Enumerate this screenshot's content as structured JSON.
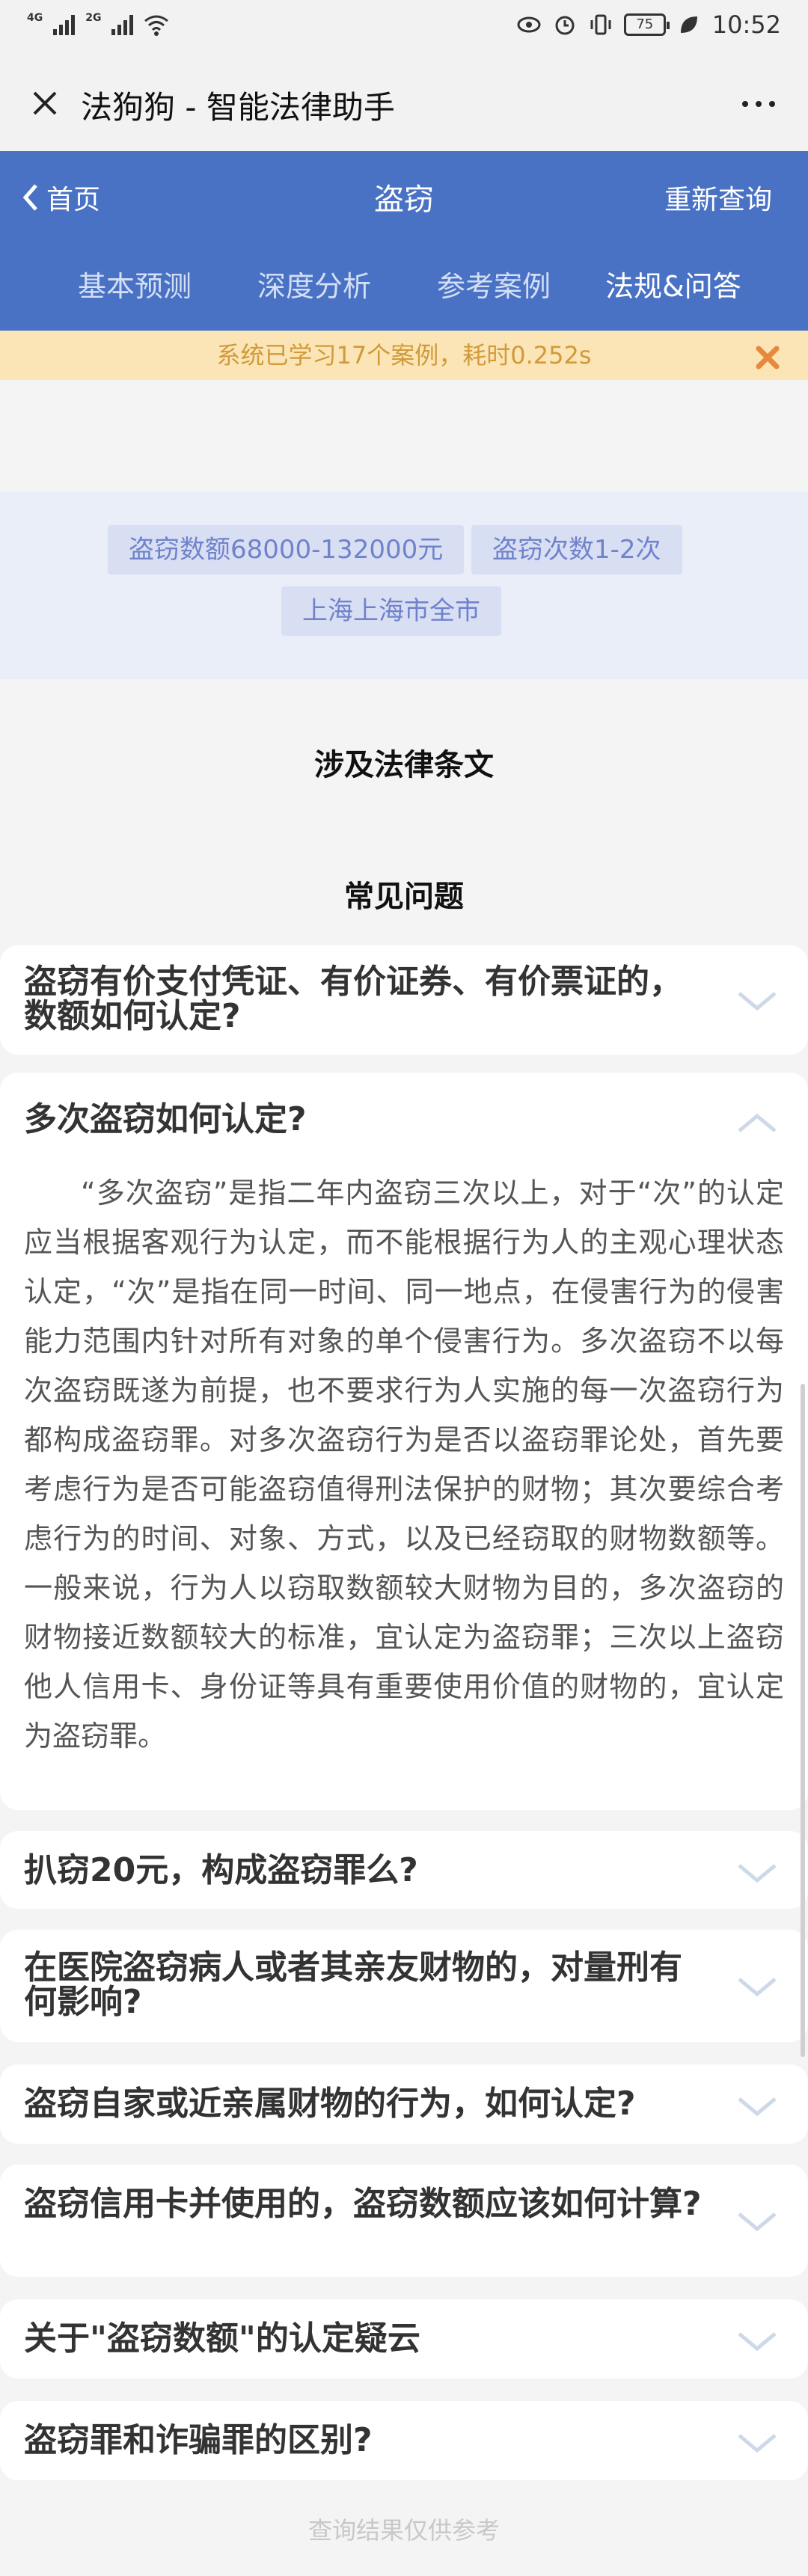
{
  "status_bar": {
    "network_1": "4G",
    "network_2": "2G",
    "battery": "75",
    "time": "10:52"
  },
  "titlebar": {
    "title": "法狗狗 - 智能法律助手"
  },
  "header": {
    "back_label": "首页",
    "page_title": "盗窃",
    "requery_label": "重新查询",
    "tabs": [
      {
        "label": "基本预测"
      },
      {
        "label": "深度分析"
      },
      {
        "label": "参考案例"
      },
      {
        "label": "法规&问答",
        "active": true
      }
    ]
  },
  "notice": {
    "text": "系统已学习17个案例，耗时0.252s"
  },
  "tags": [
    "盗窃数额68000-132000元",
    "盗窃次数1-2次",
    "上海上海市全市"
  ],
  "sections": {
    "laws_title": "涉及法律条文",
    "faq_title": "常见问题"
  },
  "faq": [
    {
      "question": "盗窃有价支付凭证、有价证券、有价票证的，数额如何认定?",
      "expanded": false
    },
    {
      "question": "多次盗窃如何认定?",
      "expanded": true,
      "answer": "“多次盗窃”是指二年内盗窃三次以上，对于“次”的认定应当根据客观行为认定，而不能根据行为人的主观心理状态认定，“次”是指在同一时间、同一地点，在侵害行为的侵害能力范围内针对所有对象的单个侵害行为。多次盗窃不以每次盗窃既遂为前提，也不要求行为人实施的每一次盗窃行为都构成盗窃罪。对多次盗窃行为是否以盗窃罪论处，首先要考虑行为是否可能盗窃值得刑法保护的财物；其次要综合考虑行为的时间、对象、方式，以及已经窃取的财物数额等。一般来说，行为人以窃取数额较大财物为目的，多次盗窃的财物接近数额较大的标准，宜认定为盗窃罪；三次以上盗窃他人信用卡、身份证等具有重要使用价值的财物的，宜认定为盗窃罪。"
    },
    {
      "question": "扒窃20元，构成盗窃罪么?",
      "expanded": false
    },
    {
      "question": "在医院盗窃病人或者其亲友财物的，对量刑有何影响?",
      "expanded": false
    },
    {
      "question": "盗窃自家或近亲属财物的行为，如何认定?",
      "expanded": false
    },
    {
      "question": "盗窃信用卡并使用的，盗窃数额应该如何计算?",
      "expanded": false
    },
    {
      "question": "关于\"盗窃数额\"的认定疑云",
      "expanded": false
    },
    {
      "question": "盗窃罪和诈骗罪的区别?",
      "expanded": false
    }
  ],
  "footer": {
    "text": "查询结果仅供参考"
  },
  "colors": {
    "header_blue": "#4a72c4",
    "notice_bg": "#fbe5b6",
    "notice_text": "#d19a3a",
    "tag_text": "#6f82cc"
  }
}
